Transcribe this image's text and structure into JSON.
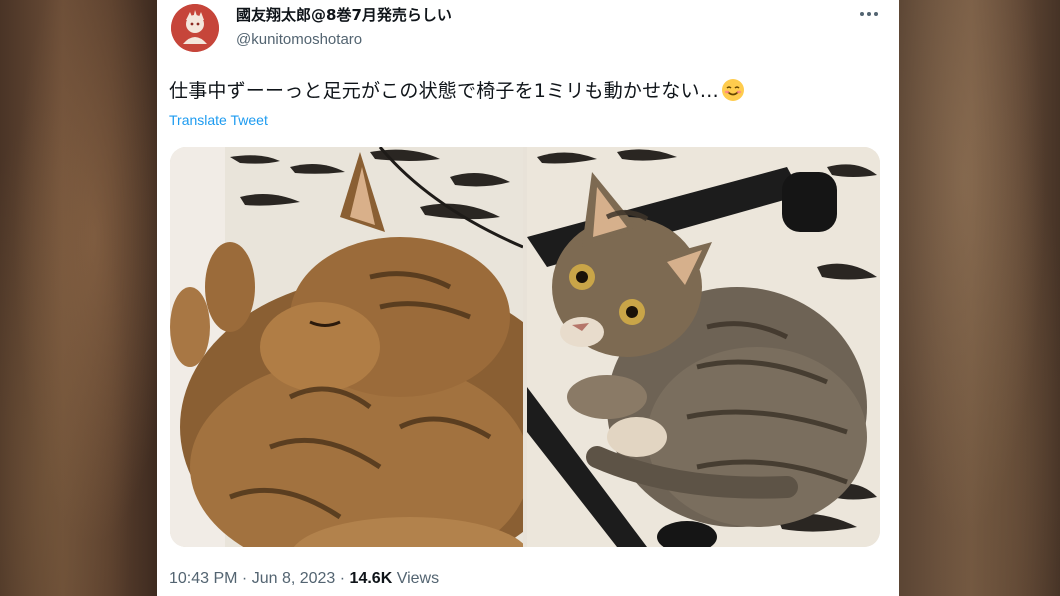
{
  "tweet": {
    "author": {
      "display_name": "國友翔太郎@8巻7月発売らしい",
      "handle": "@kunitomoshotaro",
      "avatar_icon": "avatar-illustration-icon"
    },
    "more_icon": "more-options-icon",
    "text": "仕事中ずーーっと足元がこの状態で椅子を1ミリも動かせない…",
    "emoji_icon": "smiling-face-icon",
    "translate_label": "Translate Tweet",
    "media": [
      {
        "description_icon": "sleeping-cat-photo"
      },
      {
        "description_icon": "cat-under-chair-photo"
      }
    ],
    "footer": {
      "time": "10:43 PM",
      "sep1": " · ",
      "date": "Jun 8, 2023",
      "sep2": " · ",
      "views_count": "14.6K",
      "views_label": " Views"
    }
  },
  "colors": {
    "text_primary": "#0f1419",
    "text_secondary": "#536471",
    "link": "#1d9bf0",
    "avatar_bg": "#c6453a"
  }
}
